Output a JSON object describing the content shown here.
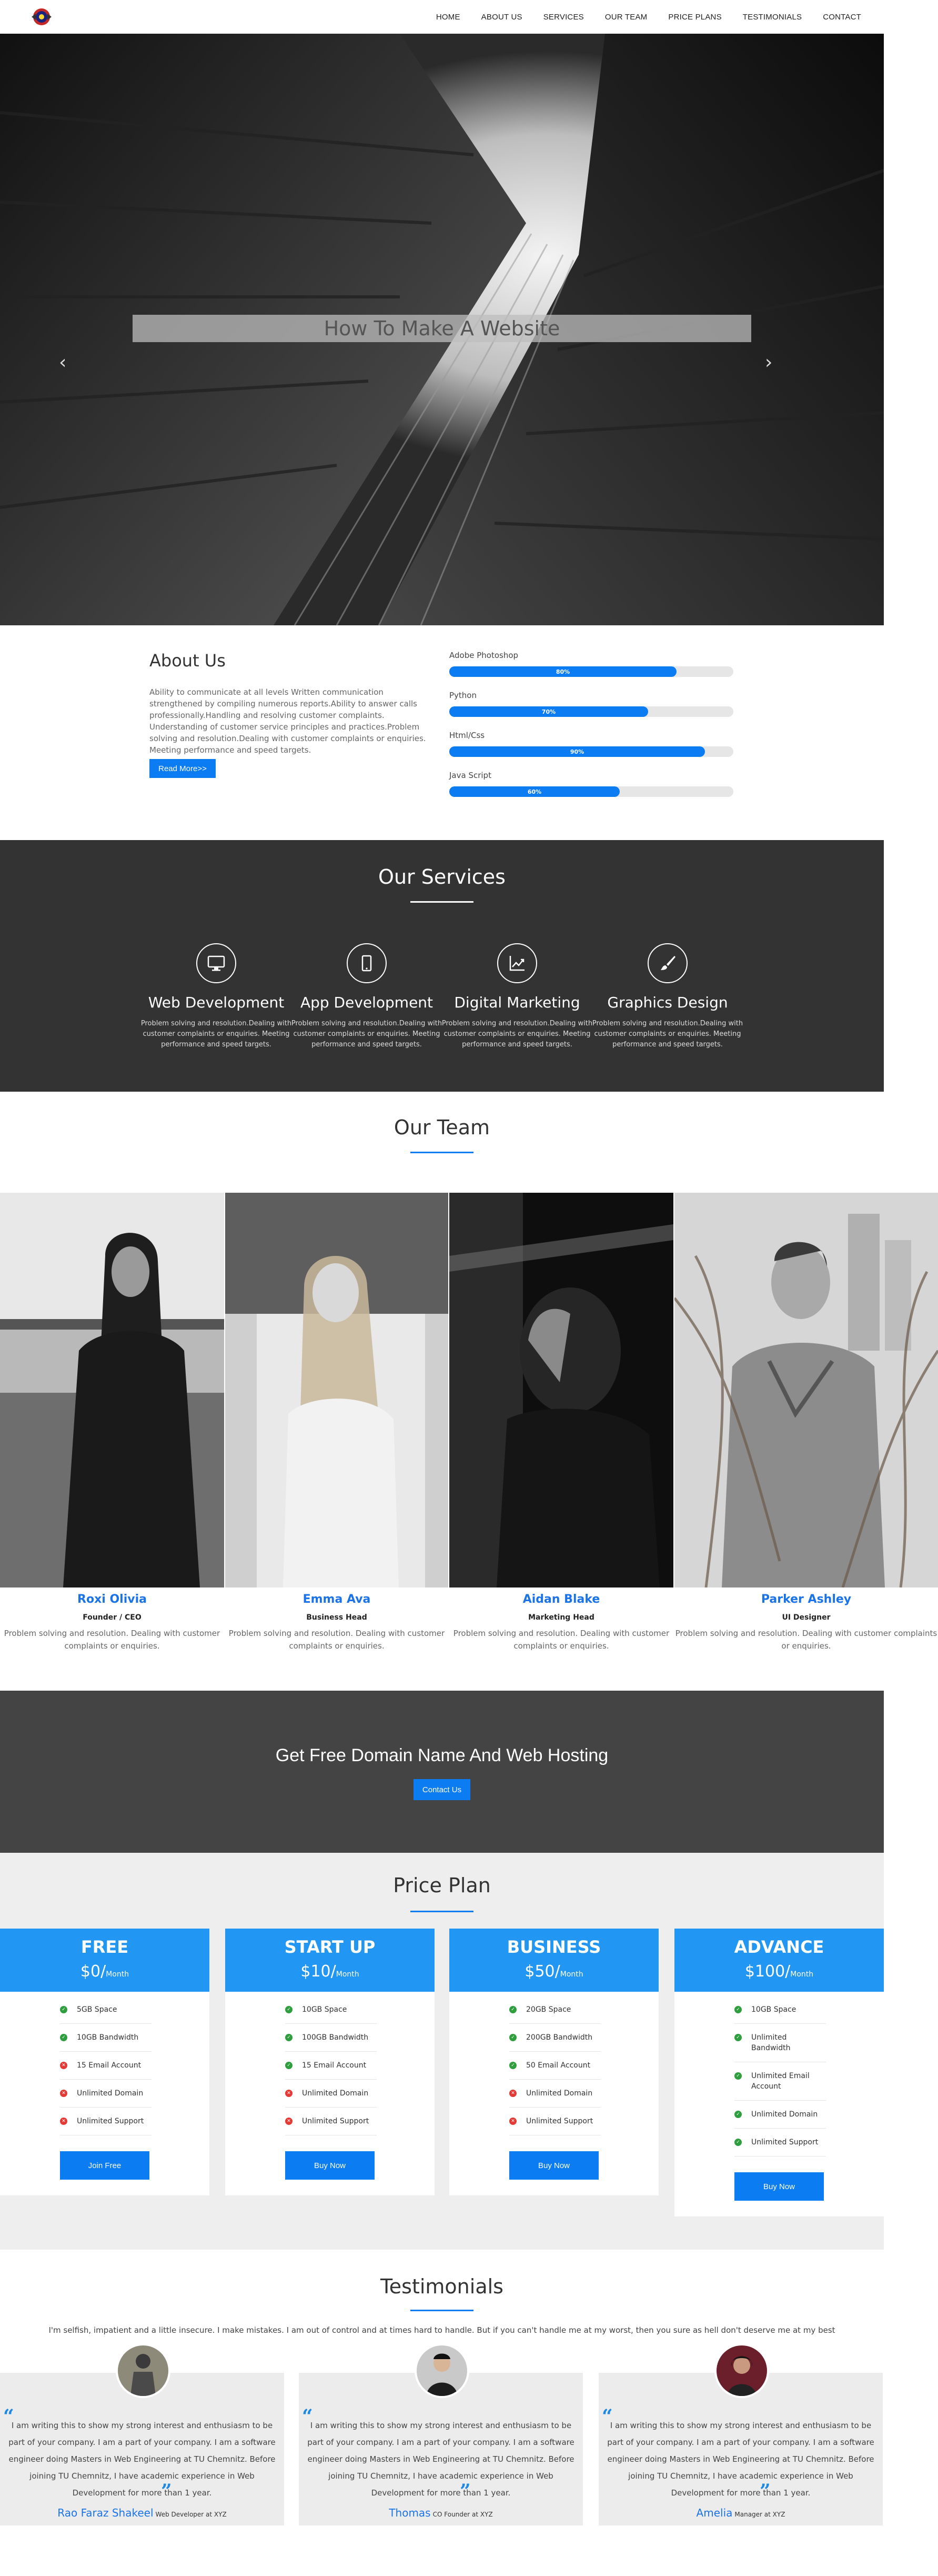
{
  "nav": {
    "logo": "logo-emblem",
    "items": [
      "HOME",
      "ABOUT US",
      "SERVICES",
      "OUR TEAM",
      "PRICE PLANS",
      "TESTIMONIALS",
      "CONTACT"
    ]
  },
  "hero": {
    "caption": "How To Make A Website",
    "prev": "‹",
    "next": "›",
    "slides": 3,
    "active_slide": 1
  },
  "about": {
    "title": "About Us",
    "text": "Ability to communicate at all levels Written communication strengthened by compiling numerous reports.Ability to answer calls professionally.Handling and resolving customer complaints. Understanding of customer service principles and practices.Problem solving and resolution.Dealing with customer complaints or enquiries. Meeting performance and speed targets.",
    "button": "Read More>>",
    "skills": [
      {
        "label": "Adobe Photoshop",
        "value": "80%",
        "percent": 80
      },
      {
        "label": "Python",
        "value": "70%",
        "percent": 70
      },
      {
        "label": "Html/Css",
        "value": "90%",
        "percent": 90
      },
      {
        "label": "Java Script",
        "value": "60%",
        "percent": 60
      }
    ]
  },
  "services": {
    "title": "Our Services",
    "items": [
      {
        "title": "Web Development",
        "icon": "desktop-icon",
        "text": "Problem solving and resolution.Dealing with customer complaints or enquiries. Meeting performance and speed targets."
      },
      {
        "title": "App Development",
        "icon": "tablet-icon",
        "text": "Problem solving and resolution.Dealing with customer complaints or enquiries. Meeting performance and speed targets."
      },
      {
        "title": "Digital Marketing",
        "icon": "chart-line-icon",
        "text": "Problem solving and resolution.Dealing with customer complaints or enquiries. Meeting performance and speed targets."
      },
      {
        "title": "Graphics Design",
        "icon": "paint-brush-icon",
        "text": "Problem solving and resolution.Dealing with customer complaints or enquiries. Meeting performance and speed targets."
      }
    ]
  },
  "team": {
    "title": "Our Team",
    "members": [
      {
        "name": "Roxi Olivia",
        "role": "Founder / CEO",
        "desc": "Problem solving and resolution. Dealing with customer complaints or enquiries."
      },
      {
        "name": "Emma Ava",
        "role": "Business Head",
        "desc": "Problem solving and resolution. Dealing with customer complaints or enquiries."
      },
      {
        "name": "Aidan Blake",
        "role": "Marketing Head",
        "desc": "Problem solving and resolution. Dealing with customer complaints or enquiries."
      },
      {
        "name": "Parker Ashley",
        "role": "UI Designer",
        "desc": "Problem solving and resolution. Dealing with customer complaints or enquiries."
      }
    ]
  },
  "cta": {
    "title": "Get Free Domain Name And Web Hosting",
    "button": "Contact Us"
  },
  "pricing": {
    "title": "Price Plan",
    "plans": [
      {
        "name": "FREE",
        "price": "$0/",
        "period": "Month",
        "button": "Join Free",
        "features": [
          {
            "text": "5GB Space",
            "ok": true
          },
          {
            "text": "10GB Bandwidth",
            "ok": true
          },
          {
            "text": "15 Email Account",
            "ok": false
          },
          {
            "text": "Unlimited Domain",
            "ok": false
          },
          {
            "text": "Unlimited Support",
            "ok": false
          }
        ]
      },
      {
        "name": "START UP",
        "price": "$10/",
        "period": "Month",
        "button": "Buy Now",
        "features": [
          {
            "text": "10GB Space",
            "ok": true
          },
          {
            "text": "100GB Bandwidth",
            "ok": true
          },
          {
            "text": "15 Email Account",
            "ok": true
          },
          {
            "text": "Unlimited Domain",
            "ok": false
          },
          {
            "text": "Unlimited Support",
            "ok": false
          }
        ]
      },
      {
        "name": "BUSINESS",
        "price": "$50/",
        "period": "Month",
        "button": "Buy Now",
        "features": [
          {
            "text": "20GB Space",
            "ok": true
          },
          {
            "text": "200GB Bandwidth",
            "ok": true
          },
          {
            "text": "50 Email Account",
            "ok": true
          },
          {
            "text": "Unlimited Domain",
            "ok": false
          },
          {
            "text": "Unlimited Support",
            "ok": false
          }
        ]
      },
      {
        "name": "ADVANCE",
        "price": "$100/",
        "period": "Month",
        "button": "Buy Now",
        "features": [
          {
            "text": "10GB Space",
            "ok": true
          },
          {
            "text": "Unlimited Bandwidth",
            "ok": true
          },
          {
            "text": "Unlimited Email Account",
            "ok": true
          },
          {
            "text": "Unlimited Domain",
            "ok": true
          },
          {
            "text": "Unlimited Support",
            "ok": true
          }
        ]
      }
    ]
  },
  "testimonials": {
    "title": "Testimonials",
    "intro": "I'm selfish, impatient and a little insecure. I make mistakes. I am out of control and at times hard to handle. But if you can't handle me at my worst, then you sure as hell don't deserve me at my best",
    "items": [
      {
        "name": "Rao Faraz Shakeel",
        "role": "Web Developer at XYZ",
        "text": "I am writing this to show my strong interest and enthusiasm to be part of your company. I am a part of your company. I am a software engineer doing Masters in Web Engineering at TU Chemnitz. Before joining TU Chemnitz, I have academic experience in Web Development for more than 1 year."
      },
      {
        "name": "Thomas",
        "role": "CO Founder at XYZ",
        "text": "I am writing this to show my strong interest and enthusiasm to be part of your company. I am a part of your company. I am a software engineer doing Masters in Web Engineering at TU Chemnitz. Before joining TU Chemnitz, I have academic experience in Web Development for more than 1 year."
      },
      {
        "name": "Amelia",
        "role": "Manager at XYZ",
        "text": "I am writing this to show my strong interest and enthusiasm to be part of your company. I am a part of your company. I am a software engineer doing Masters in Web Engineering at TU Chemnitz. Before joining TU Chemnitz, I have academic experience in Web Development for more than 1 year."
      }
    ]
  },
  "colors": {
    "accent": "#0b7cf2",
    "plan_header": "#2196f3",
    "dark_section": "#333333",
    "cta_section": "#444444",
    "price_bg": "#eeeeee",
    "check": "#2e9e3e",
    "cross": "#e53935"
  }
}
